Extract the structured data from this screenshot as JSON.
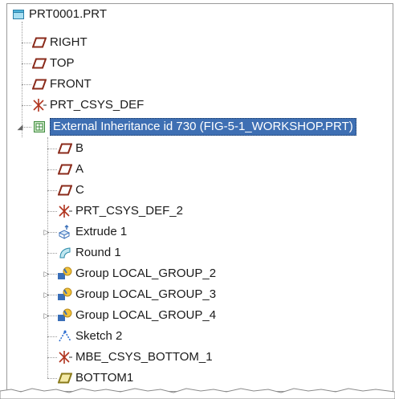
{
  "tree": {
    "root": {
      "label": "PRT0001.PRT",
      "icon": "part-icon"
    },
    "items": [
      {
        "label": "RIGHT",
        "icon": "datum-plane-icon"
      },
      {
        "label": "TOP",
        "icon": "datum-plane-icon"
      },
      {
        "label": "FRONT",
        "icon": "datum-plane-icon"
      },
      {
        "label": "PRT_CSYS_DEF",
        "icon": "coordinate-system-icon"
      },
      {
        "label": "External Inheritance id 730 (FIG-5-1_WORKSHOP.PRT)",
        "icon": "external-inheritance-icon",
        "selected": true,
        "expanded": true
      }
    ],
    "children": [
      {
        "label": "B",
        "icon": "datum-plane-icon"
      },
      {
        "label": "A",
        "icon": "datum-plane-icon"
      },
      {
        "label": "C",
        "icon": "datum-plane-icon"
      },
      {
        "label": "PRT_CSYS_DEF_2",
        "icon": "coordinate-system-icon"
      },
      {
        "label": "Extrude 1",
        "icon": "extrude-icon",
        "collapsed": true
      },
      {
        "label": "Round 1",
        "icon": "round-icon"
      },
      {
        "label": "Group LOCAL_GROUP_2",
        "icon": "group-icon",
        "collapsed": true
      },
      {
        "label": "Group LOCAL_GROUP_3",
        "icon": "group-icon",
        "collapsed": true
      },
      {
        "label": "Group LOCAL_GROUP_4",
        "icon": "group-icon",
        "collapsed": true
      },
      {
        "label": "Sketch 2",
        "icon": "sketch-icon"
      },
      {
        "label": "MBE_CSYS_BOTTOM_1",
        "icon": "coordinate-system-icon"
      },
      {
        "label": "BOTTOM1",
        "icon": "datum-plane-icon"
      }
    ]
  },
  "colors": {
    "selection": "#3e6fb3",
    "plane": "#8a2a1a",
    "csys": "#b0341e",
    "group": "#3a6fb8",
    "sketch": "#2f6fd0"
  }
}
